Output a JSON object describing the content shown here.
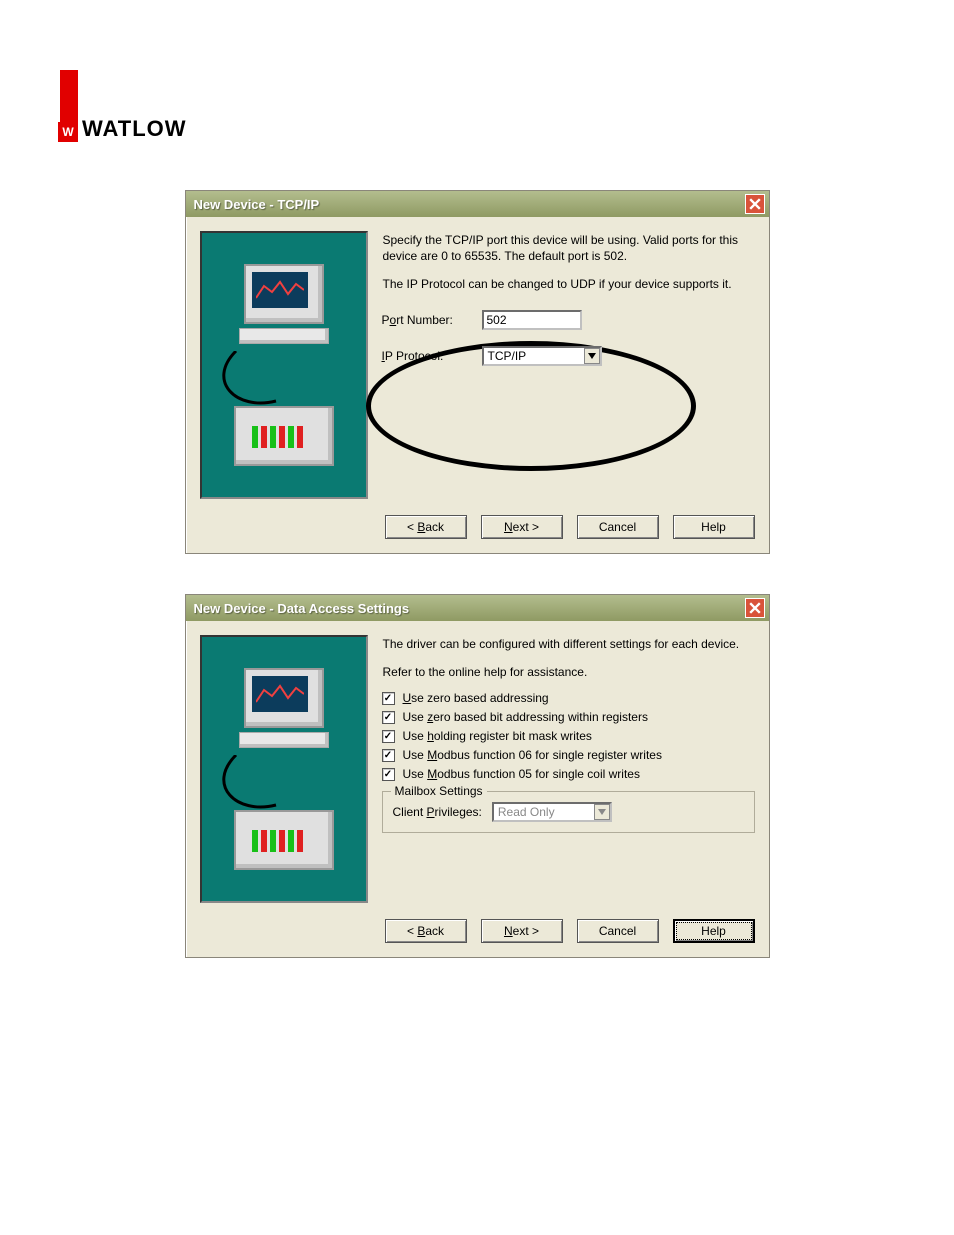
{
  "brand": {
    "name": "WATLOW",
    "badge": "W"
  },
  "dialog1": {
    "title": "New Device - TCP/IP",
    "desc1": "Specify the TCP/IP port this device will be using.  Valid ports for this device are 0 to 65535. The default port is 502.",
    "desc2": "The IP Protocol can be changed to UDP if your device supports it.",
    "port_label_pre": "P",
    "port_label_u": "o",
    "port_label_post": "rt Number:",
    "port_value": "502",
    "proto_label_pre": "",
    "proto_label_u": "I",
    "proto_label_post": "P Protocol:",
    "proto_value": "TCP/IP",
    "buttons": {
      "back": "< Back",
      "next": "Next >",
      "cancel": "Cancel",
      "help": "Help"
    }
  },
  "dialog2": {
    "title": "New Device - Data Access Settings",
    "desc1": "The driver can be configured with different settings for each device.",
    "desc2": "Refer to the online help for assistance.",
    "checks": [
      {
        "pre": "",
        "u": "U",
        "post": "se zero based addressing",
        "checked": true
      },
      {
        "pre": "Use ",
        "u": "z",
        "post": "ero based bit addressing within registers",
        "checked": true
      },
      {
        "pre": "Use ",
        "u": "h",
        "post": "olding register bit mask writes",
        "checked": true
      },
      {
        "pre": "Use ",
        "u": "M",
        "post": "odbus function 06 for single register writes",
        "checked": true
      },
      {
        "pre": "Use ",
        "u": "M",
        "post": "odbus function 05 for single coil writes",
        "checked": true
      }
    ],
    "fieldset_legend": "Mailbox Settings",
    "privileges_label_pre": "Client ",
    "privileges_label_u": "P",
    "privileges_label_post": "rivileges:",
    "privileges_value": "Read Only",
    "buttons": {
      "back": "< Back",
      "next": "Next >",
      "cancel": "Cancel",
      "help": "Help"
    }
  }
}
